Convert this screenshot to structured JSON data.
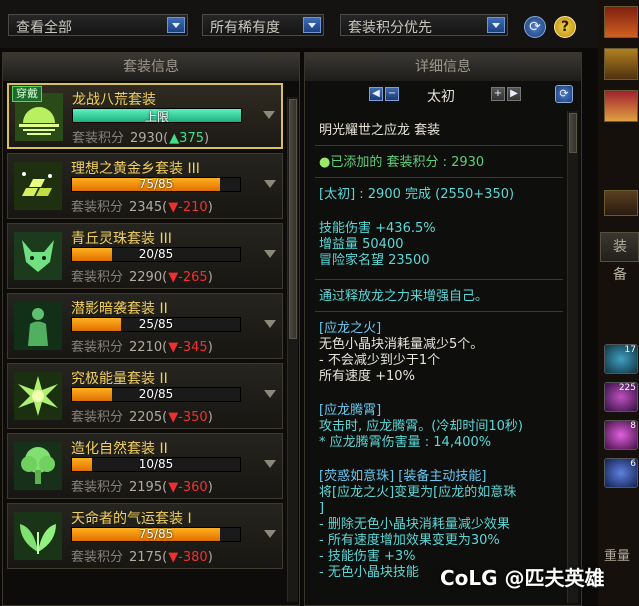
{
  "filters": {
    "view": "查看全部",
    "rarity": "所有稀有度",
    "sort": "套装积分优先"
  },
  "left_panel": {
    "title": "套装信息"
  },
  "right_panel": {
    "title": "详细信息"
  },
  "sets": [
    {
      "badge": "穿戴",
      "name": "龙战八荒套装",
      "progress_label": "上限",
      "progress": 1.0,
      "score_label": "套装积分",
      "score": "2930",
      "delta": "▲375",
      "delta_dir": "up",
      "icon": "sun-horizon-icon",
      "selected": true
    },
    {
      "name": "理想之黄金乡套装 III",
      "progress_label": "75/85",
      "progress": 0.8824,
      "score_label": "套装积分",
      "score": "2345",
      "delta": "▼-210",
      "delta_dir": "down",
      "icon": "gold-bars-icon"
    },
    {
      "name": "青丘灵珠套装 III",
      "progress_label": "20/85",
      "progress": 0.2353,
      "score_label": "套装积分",
      "score": "2290",
      "delta": "▼-265",
      "delta_dir": "down",
      "icon": "fox-icon"
    },
    {
      "name": "潜影暗袭套装 II",
      "progress_label": "25/85",
      "progress": 0.2941,
      "score_label": "套装积分",
      "score": "2210",
      "delta": "▼-345",
      "delta_dir": "down",
      "icon": "shadow-figure-icon"
    },
    {
      "name": "究极能量套装 II",
      "progress_label": "20/85",
      "progress": 0.2353,
      "score_label": "套装积分",
      "score": "2205",
      "delta": "▼-350",
      "delta_dir": "down",
      "icon": "energy-burst-icon"
    },
    {
      "name": "造化自然套装 II",
      "progress_label": "10/85",
      "progress": 0.1176,
      "score_label": "套装积分",
      "score": "2195",
      "delta": "▼-360",
      "delta_dir": "down",
      "icon": "tree-icon"
    },
    {
      "name": "天命者的气运套装 I",
      "progress_label": "75/85",
      "progress": 0.8824,
      "score_label": "套装积分",
      "score": "2175",
      "delta": "▼-380",
      "delta_dir": "down",
      "icon": "leaf-wings-icon"
    }
  ],
  "detail": {
    "nav_title": "太初",
    "set_title": "明光耀世之应龙  套装",
    "added": "已添加的 套装积分 : 2930",
    "tier_line": "[太初] : 2900 完成 (2550+350)",
    "stats": [
      "技能伤害 +436.5%",
      "增益量 50400",
      "冒险家名望 23500"
    ],
    "desc": "通过释放龙之力来增强自己。",
    "sec1_title": "[应龙之火]",
    "sec1_lines": [
      "无色小晶块消耗量减少5个。",
      "- 不会减少到少于1个",
      "所有速度 +10%"
    ],
    "sec2_title": "[应龙腾霄]",
    "sec2_lines": [
      "攻击时, 应龙腾霄。(冷却时间10秒)",
      "* 应龙腾霄伤害量 : 14,400%"
    ],
    "sec3_title": "[荧惑如意珠] [装备主动技能]",
    "sec3_lines": [
      "将[应龙之火]变更为[应龙的如意珠",
      "]",
      "- 删除无色小晶块消耗量减少效果",
      "- 所有速度增加效果变更为30%",
      "- 技能伤害 +3%",
      "- 无色小晶块技能"
    ]
  },
  "side": {
    "tab": "装备",
    "weight": "重量",
    "nums": [
      "17",
      "225",
      "8",
      "6"
    ]
  },
  "watermark": "CoLG @匹夫英雄",
  "colors": {
    "accent_gold": "#f0d060",
    "up": "#3fe08a",
    "down": "#f03030",
    "text_blue": "#68c8f0"
  }
}
